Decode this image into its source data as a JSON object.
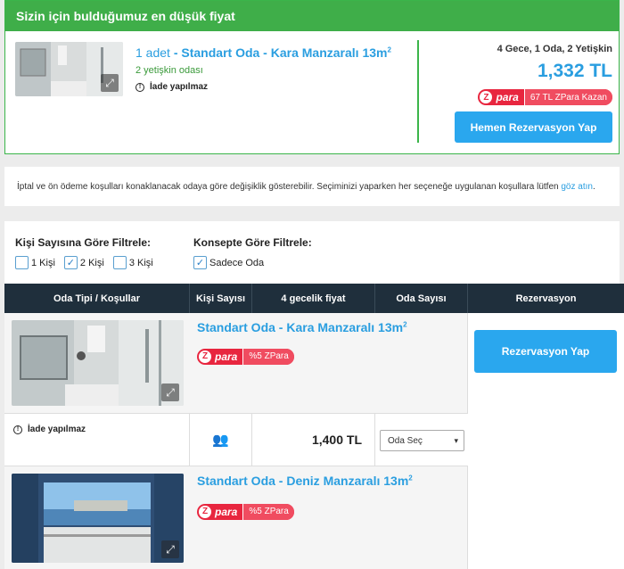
{
  "best_offer": {
    "header": "Sizin için bulduğumuz en düşük fiyat",
    "quantity": "1 adet",
    "separator": "-",
    "room_name": "Standart Oda - Kara Manzaralı 13m",
    "room_sup": "2",
    "guests": "2 yetişkin odası",
    "non_refundable": "İade yapılmaz",
    "summary": "4 Gece, 1 Oda, 2 Yetişkin",
    "price": "1,332 TL",
    "zpara_brand": "para",
    "zpara_text": "67 TL ZPara Kazan",
    "book_label": "Hemen Rezervasyon Yap"
  },
  "notice": {
    "text": "İptal ve ön ödeme koşulları konaklanacak odaya göre değişiklik gösterebilir. Seçiminizi yaparken her seçeneğe uygulanan koşullara lütfen",
    "link": "göz atın",
    "end": "."
  },
  "filters": {
    "people_title": "Kişi Sayısına Göre Filtrele:",
    "people_options": [
      {
        "label": "1 Kişi",
        "checked": false
      },
      {
        "label": "2 Kişi",
        "checked": true
      },
      {
        "label": "3 Kişi",
        "checked": false
      }
    ],
    "concept_title": "Konsepte Göre Filtrele:",
    "concept_options": [
      {
        "label": "Sadece Oda",
        "checked": true
      }
    ]
  },
  "table": {
    "headers": [
      "Oda Tipi / Koşullar",
      "Kişi Sayısı",
      "4 gecelik fiyat",
      "Oda Sayısı",
      "Rezervasyon"
    ],
    "book_label": "Rezervasyon Yap",
    "rooms": [
      {
        "name": "Standart Oda - Kara Manzaralı 13m",
        "sup": "2",
        "zpara_brand": "para",
        "zpara_text": "%5 ZPara",
        "condition": "İade yapılmaz",
        "price": "1,400 TL",
        "select": "Oda Seç"
      },
      {
        "name": "Standart Oda - Deniz Manzaralı 13m",
        "sup": "2",
        "zpara_brand": "para",
        "zpara_text": "%5 ZPara"
      }
    ]
  },
  "colors": {
    "accent": "#2aa7ee",
    "green": "#3fae49",
    "header_dark": "#1f2f3c",
    "zpara_red": "#e8263f"
  }
}
